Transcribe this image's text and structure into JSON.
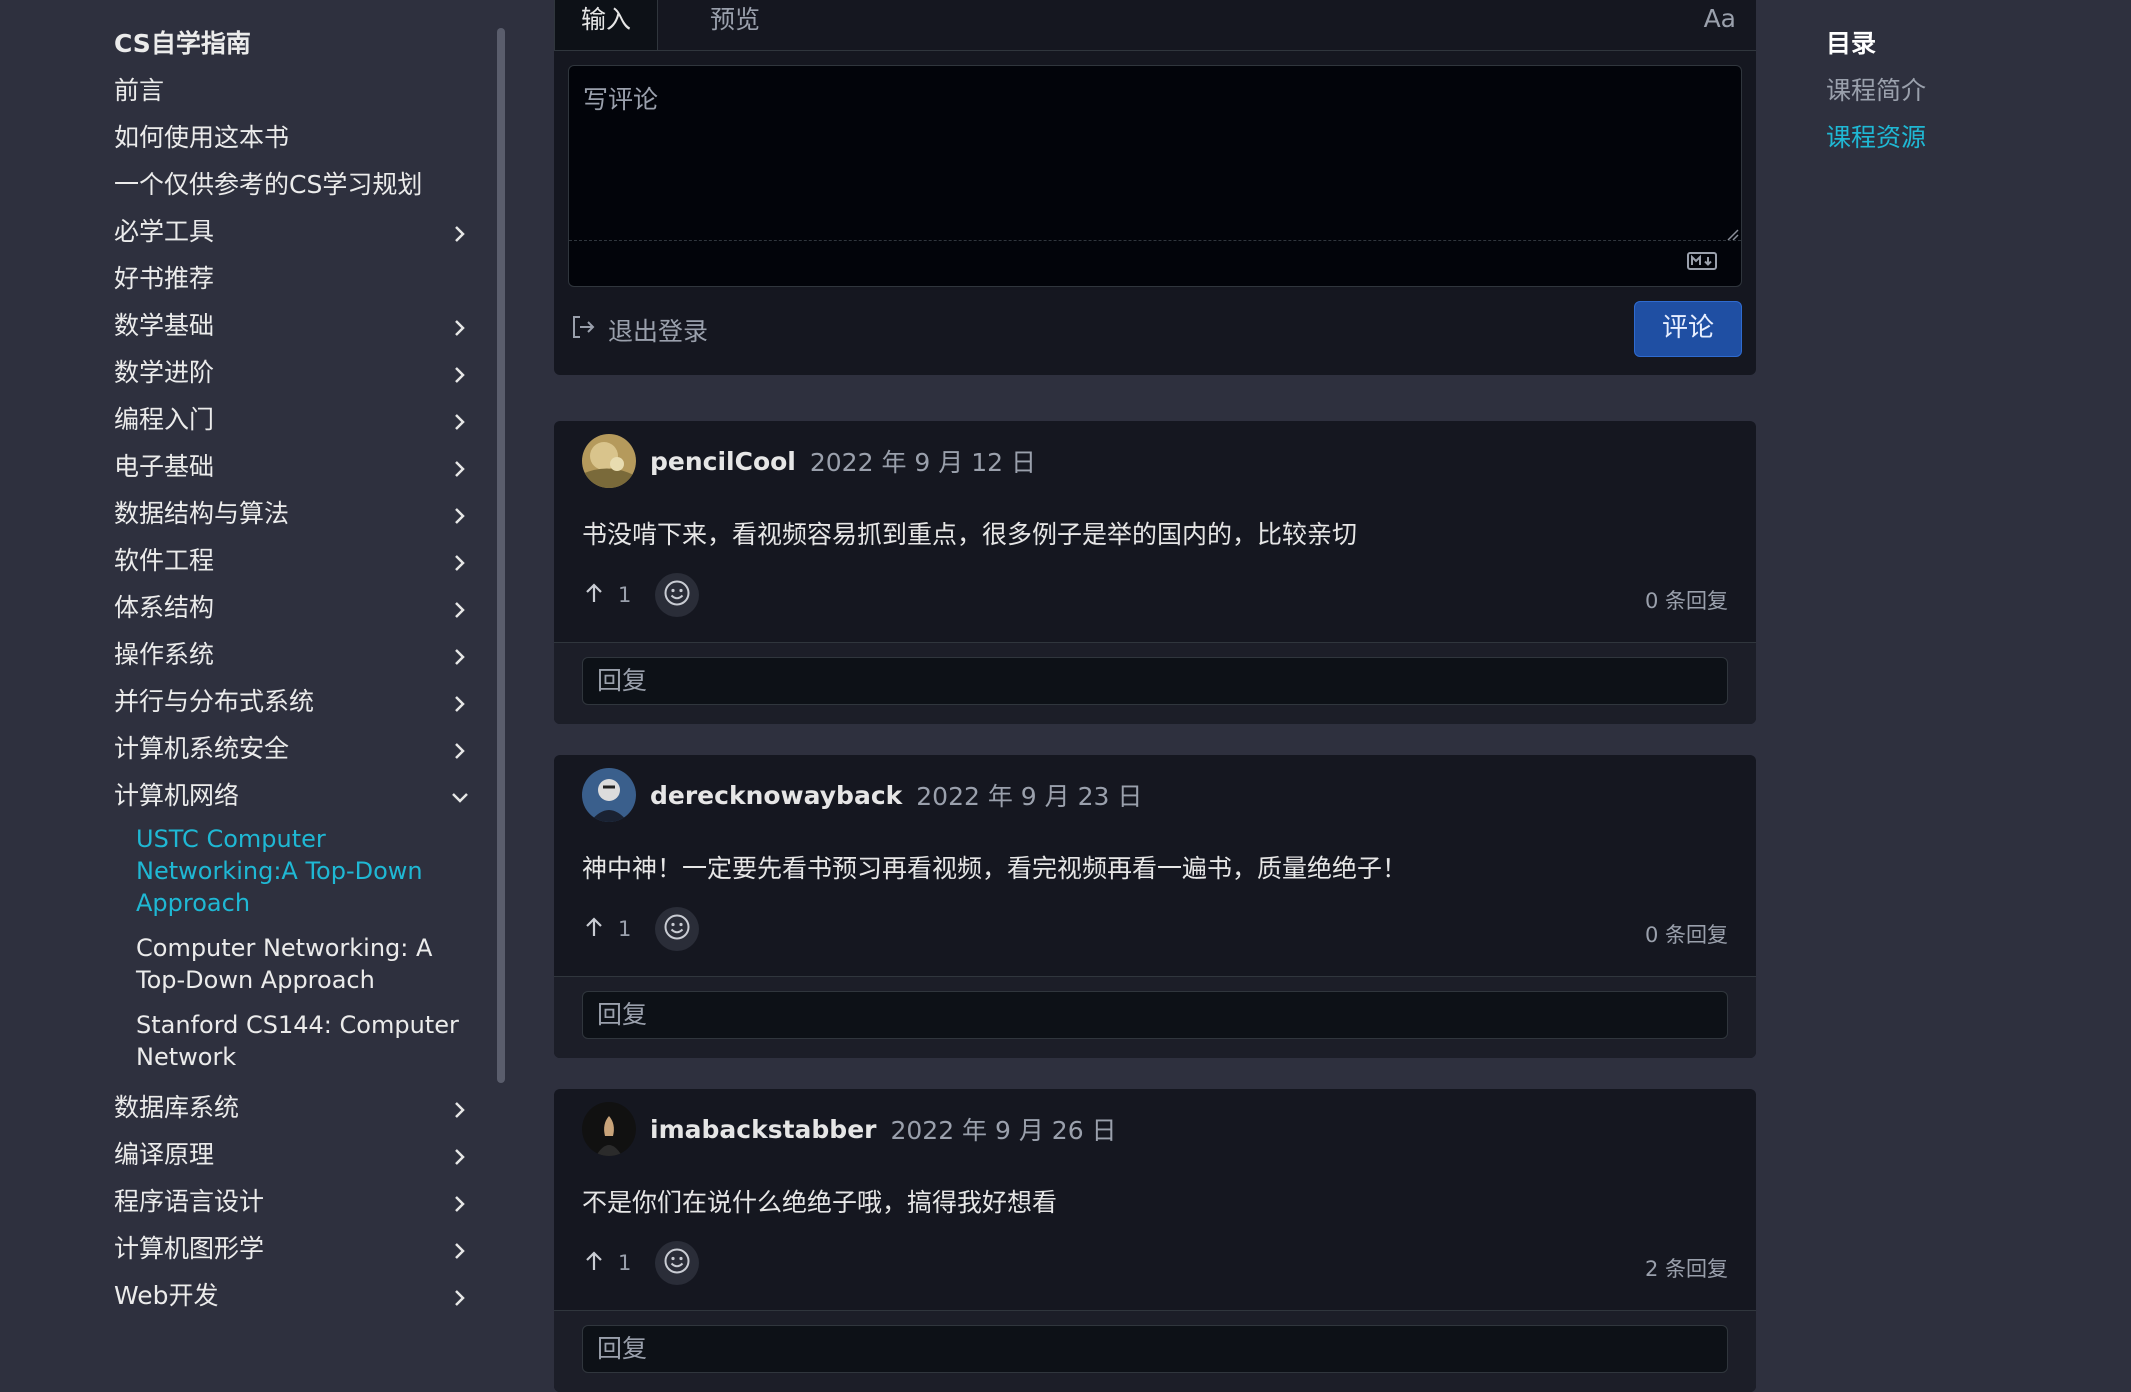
{
  "sidebar": {
    "items": [
      {
        "label": "CS自学指南",
        "title": true,
        "chevron": "none"
      },
      {
        "label": "前言",
        "chevron": "none"
      },
      {
        "label": "如何使用这本书",
        "chevron": "none"
      },
      {
        "label": "一个仅供参考的CS学习规划",
        "chevron": "none"
      },
      {
        "label": "必学工具",
        "chevron": "right"
      },
      {
        "label": "好书推荐",
        "chevron": "none"
      },
      {
        "label": "数学基础",
        "chevron": "right"
      },
      {
        "label": "数学进阶",
        "chevron": "right"
      },
      {
        "label": "编程入门",
        "chevron": "right"
      },
      {
        "label": "电子基础",
        "chevron": "right"
      },
      {
        "label": "数据结构与算法",
        "chevron": "right"
      },
      {
        "label": "软件工程",
        "chevron": "right"
      },
      {
        "label": "体系结构",
        "chevron": "right"
      },
      {
        "label": "操作系统",
        "chevron": "right"
      },
      {
        "label": "并行与分布式系统",
        "chevron": "right"
      },
      {
        "label": "计算机系统安全",
        "chevron": "right"
      },
      {
        "label": "计算机网络",
        "chevron": "down"
      }
    ],
    "sub_items": [
      {
        "label": "USTC Computer Networking:A Top-Down Approach",
        "active": true
      },
      {
        "label": "Computer Networking: A Top-Down Approach",
        "active": false
      },
      {
        "label": "Stanford CS144: Computer Network",
        "active": false
      }
    ],
    "items_after": [
      {
        "label": "数据库系统",
        "chevron": "right"
      },
      {
        "label": "编译原理",
        "chevron": "right"
      },
      {
        "label": "程序语言设计",
        "chevron": "right"
      },
      {
        "label": "计算机图形学",
        "chevron": "right"
      },
      {
        "label": "Web开发",
        "chevron": "right"
      }
    ]
  },
  "editor": {
    "tab_input": "输入",
    "tab_preview": "预览",
    "font_toggle": "Aa",
    "placeholder": "写评论",
    "logout_label": "退出登录",
    "submit_label": "评论"
  },
  "comments": [
    {
      "author": "pencilCool",
      "date": "2022 年 9 月 12 日",
      "body": "书没啃下来，看视频容易抓到重点，很多例子是举的国内的，比较亲切",
      "upvotes": "1",
      "replies": "0 条回复",
      "reply_placeholder": "回复",
      "avatar": "avatar-cat"
    },
    {
      "author": "derecknowayback",
      "date": "2022 年 9 月 23 日",
      "body": "神中神！一定要先看书预习再看视频，看完视频再看一遍书，质量绝绝子！",
      "upvotes": "1",
      "replies": "0 条回复",
      "reply_placeholder": "回复",
      "avatar": "avatar-face"
    },
    {
      "author": "imabackstabber",
      "date": "2022 年 9 月 26 日",
      "body": "不是你们在说什么绝绝子哦，搞得我好想看",
      "upvotes": "1",
      "replies": "2 条回复",
      "reply_placeholder": "回复",
      "avatar": "avatar-figure"
    }
  ],
  "toc": {
    "title": "目录",
    "items": [
      {
        "label": "课程简介",
        "active": false
      },
      {
        "label": "课程资源",
        "active": true
      }
    ]
  },
  "colors": {
    "background": "#2e303e",
    "card": "#151720",
    "accent_link": "#1fb8d4",
    "button": "#1f4fa3"
  }
}
